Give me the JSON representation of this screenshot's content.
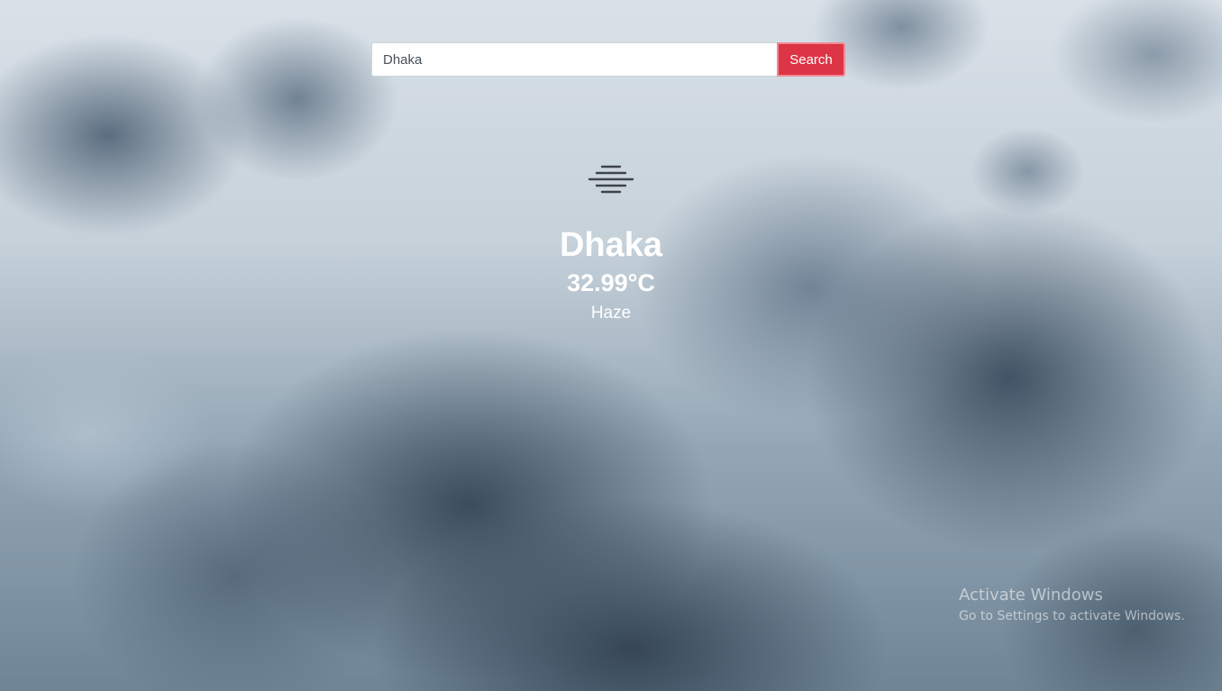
{
  "search": {
    "value": "Dhaka",
    "button_label": "Search"
  },
  "weather": {
    "icon": "haze-icon",
    "city": "Dhaka",
    "temperature": "32.99°C",
    "condition": "Haze"
  },
  "watermark": {
    "title": "Activate Windows",
    "subtitle": "Go to Settings to activate Windows."
  },
  "colors": {
    "accent": "#dc3545",
    "text": "#ffffff"
  }
}
